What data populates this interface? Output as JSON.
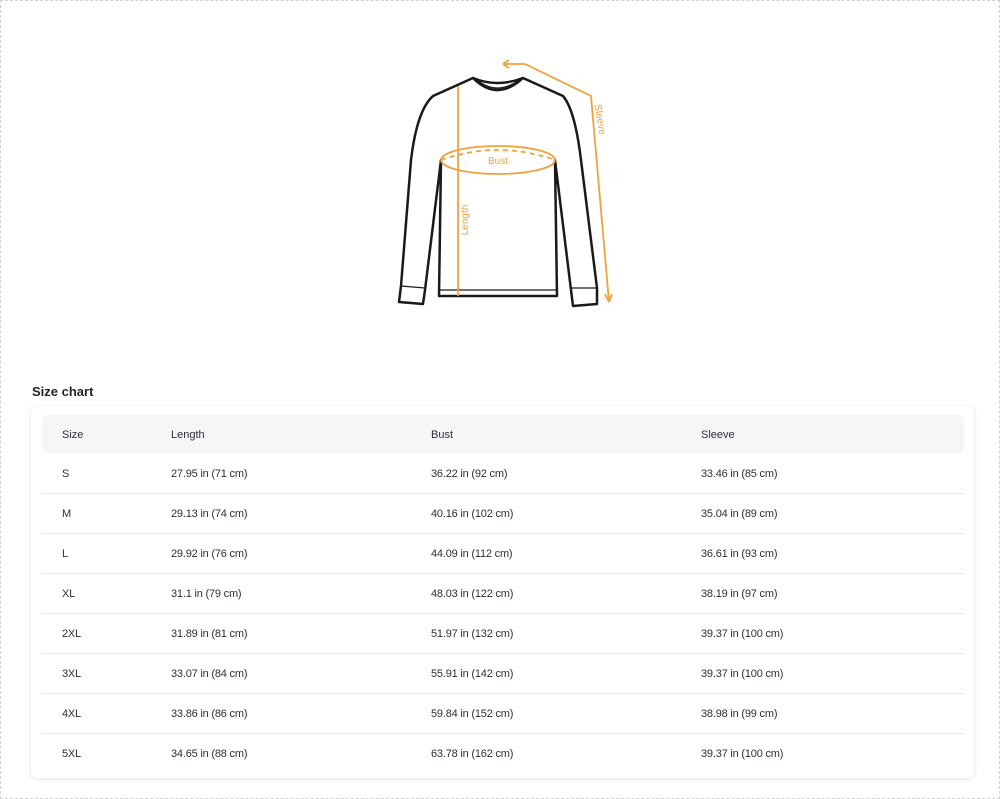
{
  "illustration": {
    "labels": {
      "bust": "Bust",
      "length": "Length",
      "sleeve": "Sleeve"
    },
    "colors": {
      "outline": "#1a1a1a",
      "measure": "#f0a23c"
    }
  },
  "size_chart": {
    "title": "Size chart",
    "headers": [
      "Size",
      "Length",
      "Bust",
      "Sleeve"
    ],
    "rows": [
      [
        "S",
        "27.95 in  (71 cm)",
        "36.22 in  (92 cm)",
        "33.46 in  (85 cm)"
      ],
      [
        "M",
        "29.13 in  (74 cm)",
        "40.16 in  (102 cm)",
        "35.04 in  (89 cm)"
      ],
      [
        "L",
        "29.92 in  (76 cm)",
        "44.09 in  (112 cm)",
        "36.61 in  (93 cm)"
      ],
      [
        "XL",
        "31.1 in  (79 cm)",
        "48.03 in  (122 cm)",
        "38.19 in  (97 cm)"
      ],
      [
        "2XL",
        "31.89 in  (81 cm)",
        "51.97 in  (132 cm)",
        "39.37 in  (100 cm)"
      ],
      [
        "3XL",
        "33.07 in  (84 cm)",
        "55.91 in  (142 cm)",
        "39.37 in  (100 cm)"
      ],
      [
        "4XL",
        "33.86 in  (86 cm)",
        "59.84 in  (152 cm)",
        "38.98 in  (99 cm)"
      ],
      [
        "5XL",
        "34.65 in  (88 cm)",
        "63.78 in  (162 cm)",
        "39.37 in  (100 cm)"
      ]
    ]
  }
}
